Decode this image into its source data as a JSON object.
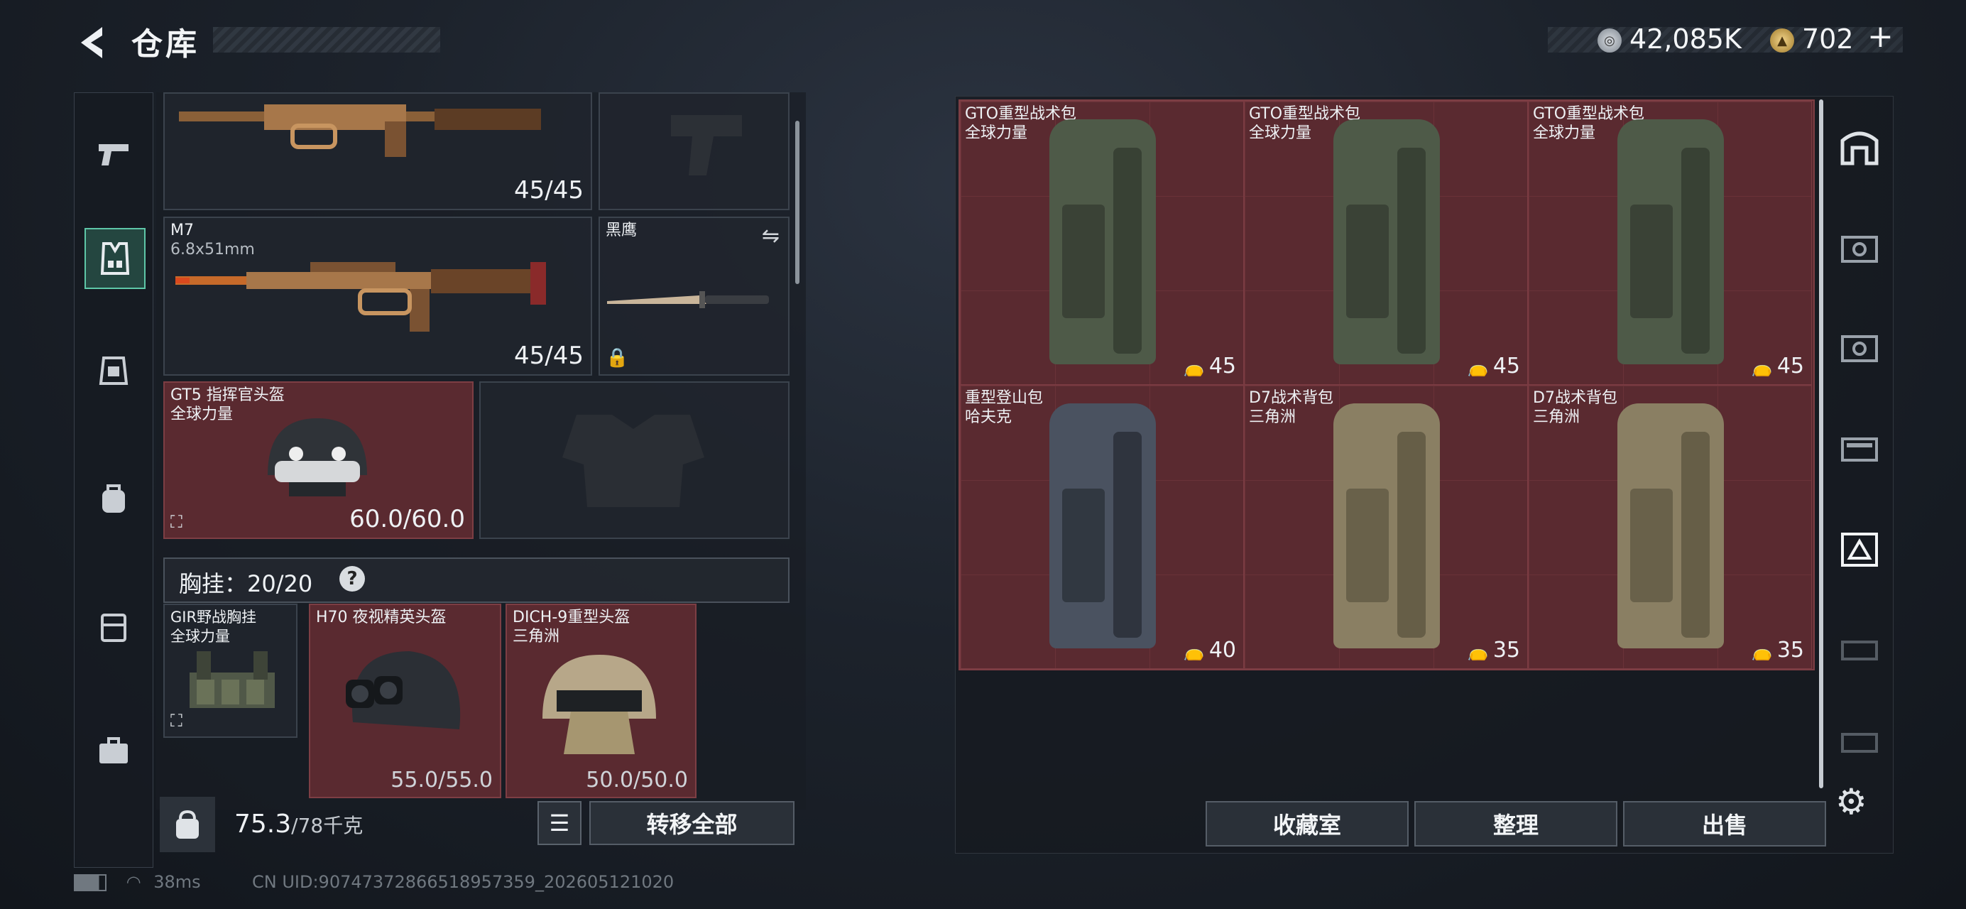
{
  "header": {
    "back_icon": "chevron-left-icon",
    "title": "仓库",
    "currency1_icon": "silver-coin-icon",
    "currency1": "42,085K",
    "currency2_icon": "gold-coin-icon",
    "currency2": "702",
    "plus": "+"
  },
  "left_nav": {
    "items": [
      {
        "icon": "pistol-icon"
      },
      {
        "icon": "vest-icon"
      },
      {
        "icon": "armor-plate-icon"
      },
      {
        "icon": "backpack-icon"
      },
      {
        "icon": "storage-case-icon"
      },
      {
        "icon": "toolbox-icon"
      }
    ]
  },
  "loadout": {
    "primary_ammo": "45/45",
    "secondary_name": "M7",
    "secondary_caliber": "6.8x51mm",
    "secondary_ammo": "45/45",
    "melee_name": "黑鹰",
    "helmet_name": "GT5 指挥官头盔",
    "helmet_source": "全球力量",
    "helmet_durability": "60.0/60.0",
    "vest_label": "胸挂：",
    "vest_value": "20/20",
    "vest_help": "?",
    "vest_item_name": "GIR野战胸挂",
    "vest_item_source": "全球力量",
    "item2_name": "H70 夜视精英头盔",
    "item2_durability": "55.0/55.0",
    "item3_name": "DICH-9重型头盔",
    "item3_source": "三角洲",
    "item3_durability": "50.0/50.0"
  },
  "footer_left": {
    "weight_value": "75.3",
    "weight_max": "/78千克",
    "transfer_all": "转移全部"
  },
  "backpacks": [
    {
      "name": "GTO重型战术包",
      "source": "全球力量",
      "capacity": "45",
      "color": "#4e5a48"
    },
    {
      "name": "GTO重型战术包",
      "source": "全球力量",
      "capacity": "45",
      "color": "#4e5a48"
    },
    {
      "name": "GTO重型战术包",
      "source": "全球力量",
      "capacity": "45",
      "color": "#4e5a48"
    },
    {
      "name": "重型登山包",
      "source": "哈夫克",
      "capacity": "40",
      "color": "#4a5260"
    },
    {
      "name": "D7战术背包",
      "source": "三角洲",
      "capacity": "35",
      "color": "#8a7f63"
    },
    {
      "name": "D7战术背包",
      "source": "三角洲",
      "capacity": "35",
      "color": "#8a7f63"
    }
  ],
  "footer_right": {
    "collection": "收藏室",
    "sort": "整理",
    "sell": "出售"
  },
  "status": {
    "ping": "38ms",
    "uid": "CN UID:9074737286651895735​9_202605121020"
  }
}
